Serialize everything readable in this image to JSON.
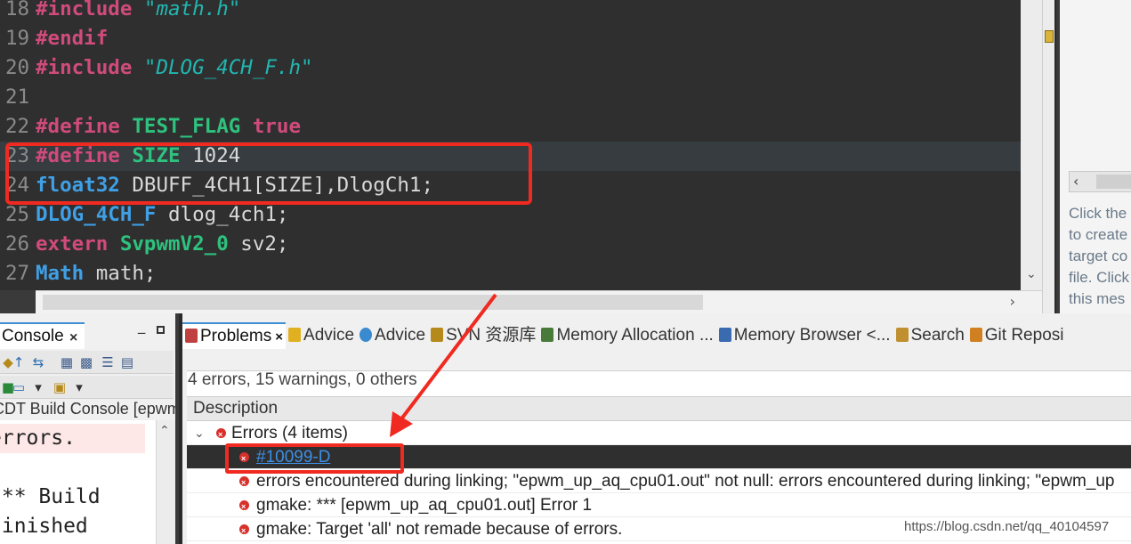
{
  "editor": {
    "lines": [
      {
        "num": "18",
        "tokens": [
          {
            "t": "#include ",
            "c": "kw"
          },
          {
            "t": "\"math.h\"",
            "c": "str"
          }
        ]
      },
      {
        "num": "19",
        "tokens": [
          {
            "t": "#endif",
            "c": "kw"
          }
        ]
      },
      {
        "num": "20",
        "tokens": [
          {
            "t": "#include ",
            "c": "kw"
          },
          {
            "t": "\"DLOG_4CH_F.h\"",
            "c": "str"
          }
        ]
      },
      {
        "num": "21",
        "tokens": []
      },
      {
        "num": "22",
        "tokens": [
          {
            "t": "#define ",
            "c": "kw"
          },
          {
            "t": "TEST_FLAG ",
            "c": "mac"
          },
          {
            "t": "true",
            "c": "kw"
          }
        ]
      },
      {
        "num": "23",
        "tokens": [
          {
            "t": "#define ",
            "c": "kw"
          },
          {
            "t": "SIZE ",
            "c": "mac"
          },
          {
            "t": "1024",
            "c": "txt"
          }
        ]
      },
      {
        "num": "24",
        "tokens": [
          {
            "t": "float32 ",
            "c": "typ"
          },
          {
            "t": "DBUFF_4CH1[SIZE],DlogCh1;",
            "c": "txt"
          }
        ]
      },
      {
        "num": "25",
        "tokens": [
          {
            "t": "DLOG_4CH_F ",
            "c": "typ"
          },
          {
            "t": "dlog_4ch1;",
            "c": "txt"
          }
        ]
      },
      {
        "num": "26",
        "tokens": [
          {
            "t": "extern ",
            "c": "kw"
          },
          {
            "t": "SvpwmV2_0 ",
            "c": "mac"
          },
          {
            "t": "sv2;",
            "c": "txt"
          }
        ]
      },
      {
        "num": "27",
        "tokens": [
          {
            "t": "Math ",
            "c": "typ"
          },
          {
            "t": "math;",
            "c": "txt"
          }
        ]
      }
    ],
    "current_line": "23",
    "scroll_right_icon": "›",
    "scroll_down_icon": "⌄"
  },
  "outline": {
    "scroll_left_icon": "‹",
    "message_lines": [
      "Click the",
      "to create",
      "target co",
      "file. Click",
      "this mes"
    ]
  },
  "console": {
    "tab_label": "Console",
    "close_icon": "×",
    "minimize_icon": "‒",
    "title": "CDT Build Console [epwm",
    "lines": [
      {
        "text": "errors.",
        "error": true
      },
      {
        "text": "",
        "error": false
      },
      {
        "text": "*** Build",
        "error": false
      },
      {
        "text": "finished",
        "error": false
      }
    ],
    "scroll_up_icon": "⌃"
  },
  "problems": {
    "tabs": [
      {
        "label": "Problems",
        "active": true,
        "icon": "problems-icon"
      },
      {
        "label": "Advice",
        "active": false,
        "icon": "lightbulb-icon"
      },
      {
        "label": "Advice",
        "active": false,
        "icon": "globe-icon"
      },
      {
        "label": "SVN 资源库",
        "active": false,
        "icon": "svn-icon"
      },
      {
        "label": "Memory Allocation ...",
        "active": false,
        "icon": "memory-allocation-icon"
      },
      {
        "label": "Memory Browser <...",
        "active": false,
        "icon": "memory-browser-icon"
      },
      {
        "label": "Search",
        "active": false,
        "icon": "search-icon"
      },
      {
        "label": "Git Reposi",
        "active": false,
        "icon": "git-icon"
      }
    ],
    "close_icon": "×",
    "summary": "4 errors, 15 warnings, 0 others",
    "column_header": "Description",
    "group": {
      "label": "Errors (4 items)",
      "chevron": "⌄"
    },
    "items": [
      {
        "text": "#10099-D",
        "link": true,
        "selected": true
      },
      {
        "text": "errors encountered during linking; \"epwm_up_aq_cpu01.out\" not null: errors encountered during linking; \"epwm_up",
        "link": false,
        "selected": false
      },
      {
        "text": "gmake: *** [epwm_up_aq_cpu01.out] Error 1",
        "link": false,
        "selected": false
      },
      {
        "text": "gmake: Target 'all' not remade because of errors.",
        "link": false,
        "selected": false
      }
    ]
  },
  "watermark": "https://blog.csdn.net/qq_40104597",
  "colors": {
    "keyword": "#d04b7b",
    "macro": "#2ec27e",
    "string": "#22b6b0",
    "type": "#3fa0e6",
    "annotation": "#f02a20",
    "link": "#3d8fe6"
  }
}
